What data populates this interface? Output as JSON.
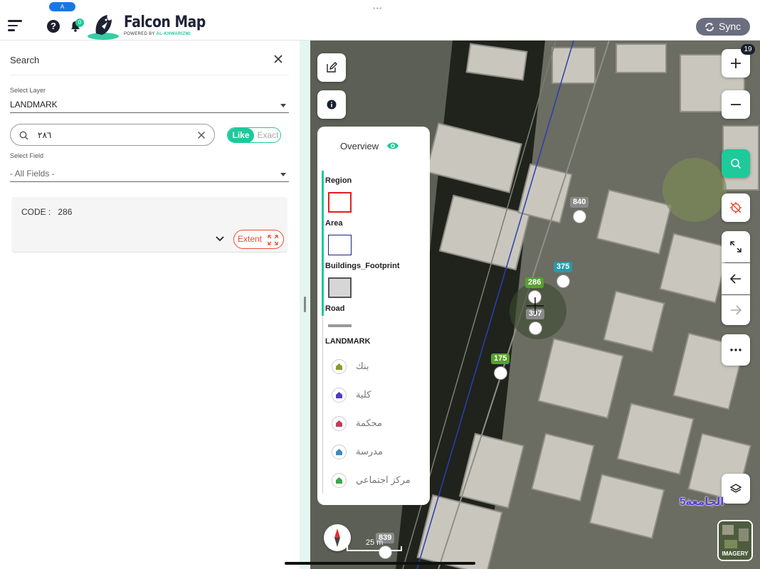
{
  "header": {
    "top_pill": "A",
    "notification_count": "0",
    "logo_title": "Falcon Map",
    "logo_sub_prefix": "POWERED BY ",
    "logo_sub_brand": "AL-KHWARIZMI",
    "sync_label": "Sync"
  },
  "search_panel": {
    "title": "Search",
    "layer_label": "Select Layer",
    "layer_value": "LANDMARK",
    "search_value": "٢٨٦",
    "toggle_like": "Like",
    "toggle_exact": "Exact",
    "field_label": "Select Field",
    "field_value": "- All Fields -",
    "result": {
      "code_label": "CODE :",
      "code_value": "286",
      "extent_label": "Extent"
    }
  },
  "map": {
    "zoom_level": "19",
    "legend": {
      "overview_label": "Overview",
      "region": "Region",
      "area": "Area",
      "buildings": "Buildings_Footprint",
      "road": "Road",
      "landmark": "LANDMARK",
      "landmark_items": [
        {
          "label": "بنك",
          "color": "#8a9a2a"
        },
        {
          "label": "كلية",
          "color": "#4b3cc6"
        },
        {
          "label": "محكمة",
          "color": "#c43a5a"
        },
        {
          "label": "مدرسة",
          "color": "#3a8ac4"
        },
        {
          "label": "مركز اجتماعي",
          "color": "#3aa84a"
        }
      ]
    },
    "markers": [
      {
        "label": "840",
        "color": "#8a8a8a"
      },
      {
        "label": "375",
        "color": "#2a9aa8"
      },
      {
        "label": "286",
        "color": "#5aa030"
      },
      {
        "label": "397",
        "color": "#8a8a8a"
      },
      {
        "label": "175",
        "color": "#5aa030"
      },
      {
        "label": "839",
        "color": "#8a8a8a"
      }
    ],
    "scale_label": "25 m",
    "place_label": "الجامعة5",
    "imagery_label": "IMAGERY"
  }
}
